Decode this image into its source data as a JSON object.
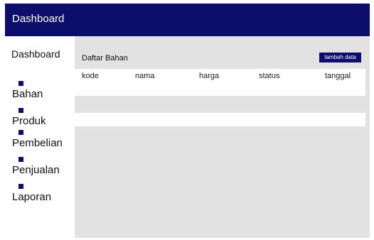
{
  "header": {
    "title": "Dashboard"
  },
  "sidebar": {
    "dashboard_label": "Dashboard",
    "items": [
      {
        "label": "Bahan",
        "icon": "square-bullet-icon"
      },
      {
        "label": "Produk",
        "icon": "square-bullet-icon"
      },
      {
        "label": "Pembelian",
        "icon": "square-bullet-icon"
      },
      {
        "label": "Penjualan",
        "icon": "square-bullet-icon"
      },
      {
        "label": "Laporan",
        "icon": "square-bullet-icon"
      }
    ]
  },
  "main": {
    "section_title": "Daftar Bahan",
    "add_button_label": "tambah data",
    "table": {
      "columns": [
        "kode",
        "nama",
        "harga",
        "status",
        "tanggal"
      ],
      "rows": []
    }
  },
  "colors": {
    "accent": "#0d0d6b",
    "content_bg": "#e2e2e2",
    "panel_bg": "#ffffff"
  }
}
